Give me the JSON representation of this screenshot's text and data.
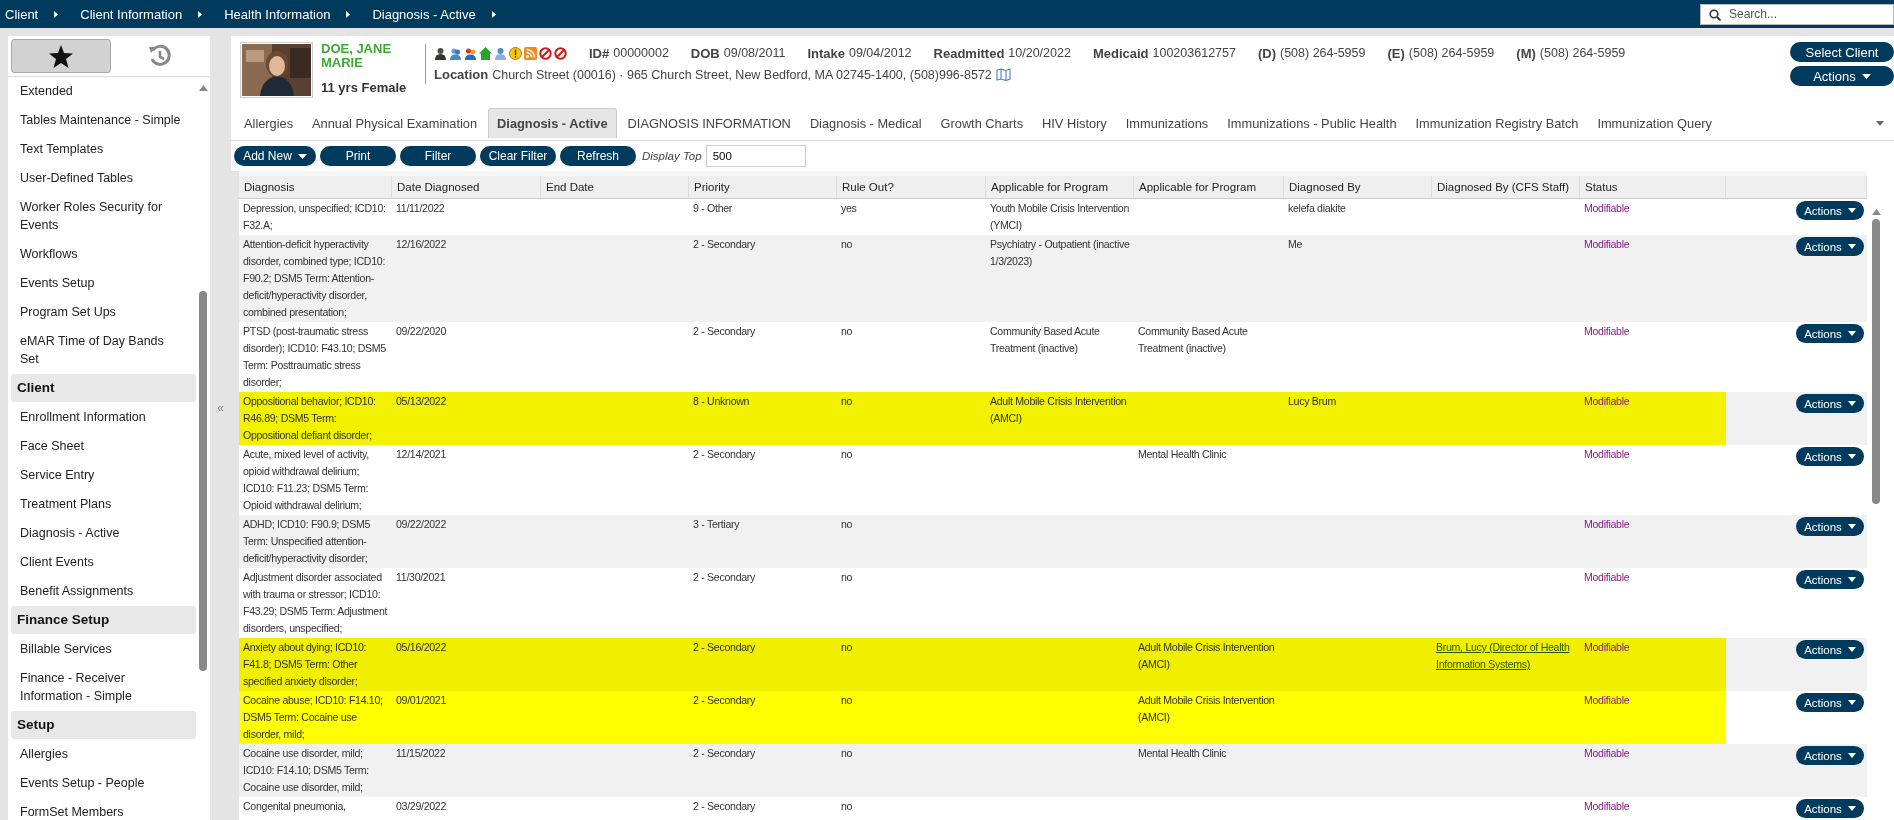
{
  "breadcrumb": [
    {
      "label": "Client"
    },
    {
      "label": "Client Information"
    },
    {
      "label": "Health Information"
    },
    {
      "label": "Diagnosis - Active"
    }
  ],
  "search": {
    "placeholder": "Search..."
  },
  "sidebar": {
    "tabs": [
      {
        "kind": "favorites",
        "selected": true
      },
      {
        "kind": "history",
        "selected": false
      }
    ],
    "items": [
      {
        "kind": "item",
        "label": "Extended"
      },
      {
        "kind": "item",
        "label": "Tables Maintenance - Simple"
      },
      {
        "kind": "item",
        "label": "Text Templates"
      },
      {
        "kind": "item",
        "label": "User-Defined Tables"
      },
      {
        "kind": "item",
        "label": "Worker Roles Security for Events"
      },
      {
        "kind": "item",
        "label": "Workflows"
      },
      {
        "kind": "item",
        "label": "Events Setup"
      },
      {
        "kind": "item",
        "label": "Program Set Ups"
      },
      {
        "kind": "item",
        "label": "eMAR Time of Day Bands Set"
      },
      {
        "kind": "group",
        "label": "Client"
      },
      {
        "kind": "item",
        "label": "Enrollment Information"
      },
      {
        "kind": "item",
        "label": "Face Sheet"
      },
      {
        "kind": "item",
        "label": "Service Entry"
      },
      {
        "kind": "item",
        "label": "Treatment Plans"
      },
      {
        "kind": "item",
        "label": "Diagnosis - Active"
      },
      {
        "kind": "item",
        "label": "Client Events"
      },
      {
        "kind": "item",
        "label": "Benefit Assignments"
      },
      {
        "kind": "group",
        "label": "Finance Setup"
      },
      {
        "kind": "item",
        "label": "Billable Services"
      },
      {
        "kind": "item",
        "label": "Finance - Receiver Information - Simple"
      },
      {
        "kind": "group",
        "label": "Setup"
      },
      {
        "kind": "item",
        "label": "Allergies"
      },
      {
        "kind": "item",
        "label": "Events Setup - People"
      },
      {
        "kind": "item",
        "label": "FormSet Members"
      }
    ]
  },
  "collapse_handle": "«",
  "client": {
    "name": "DOE, JANE MARIE",
    "age_sex": "11 yrs Female",
    "flags": [
      {
        "kind": "staff"
      },
      {
        "kind": "group"
      },
      {
        "kind": "family"
      },
      {
        "kind": "home"
      },
      {
        "kind": "user"
      },
      {
        "kind": "alert"
      },
      {
        "kind": "feed"
      },
      {
        "kind": "blocked"
      },
      {
        "kind": "blocked"
      }
    ],
    "fields": [
      {
        "label": "ID#",
        "value": "00000002"
      },
      {
        "label": "DOB",
        "value": "09/08/2011"
      },
      {
        "label": "Intake",
        "value": "09/04/2012"
      },
      {
        "label": "Readmitted",
        "value": "10/20/2022"
      },
      {
        "label": "Medicaid",
        "value": "100203612757"
      },
      {
        "label": "(D)",
        "value": "(508) 264-5959"
      },
      {
        "label": "(E)",
        "value": "(508) 264-5959"
      },
      {
        "label": "(M)",
        "value": "(508) 264-5959"
      }
    ],
    "location": {
      "label": "Location",
      "value": "Church Street (00016) · 965 Church Street, New Bedford, MA 02745-1400, (508)996-8572"
    }
  },
  "header_buttons": [
    {
      "label": "Select Client",
      "dropdown": false
    },
    {
      "label": "Actions",
      "dropdown": true
    }
  ],
  "tabs": [
    {
      "label": "Allergies",
      "selected": false
    },
    {
      "label": "Annual Physical Examination",
      "selected": false
    },
    {
      "label": "Diagnosis - Active",
      "selected": true
    },
    {
      "label": "DIAGNOSIS INFORMATION",
      "selected": false
    },
    {
      "label": "Diagnosis - Medical",
      "selected": false
    },
    {
      "label": "Growth Charts",
      "selected": false
    },
    {
      "label": "HIV History",
      "selected": false
    },
    {
      "label": "Immunizations",
      "selected": false
    },
    {
      "label": "Immunizations - Public Health",
      "selected": false
    },
    {
      "label": "Immunization Registry Batch",
      "selected": false
    },
    {
      "label": "Immunization Query",
      "selected": false
    }
  ],
  "toolbar": {
    "buttons": [
      {
        "label": "Add New",
        "dropdown": true
      },
      {
        "label": "Print",
        "dropdown": false
      },
      {
        "label": "Filter",
        "dropdown": false
      },
      {
        "label": "Clear Filter",
        "dropdown": false
      },
      {
        "label": "Refresh",
        "dropdown": false
      }
    ],
    "display_top": {
      "label": "Display Top",
      "value": "500"
    }
  },
  "table": {
    "columns": [
      "Diagnosis",
      "Date Diagnosed",
      "End Date",
      "Priority",
      "Rule Out?",
      "Applicable for Program",
      "Applicable for Program",
      "Diagnosed By",
      "Diagnosed By (CFS Staff)",
      "Status"
    ],
    "rows": [
      {
        "diagnosis": "Depression, unspecified; ICD10: F32.A;",
        "date_diagnosed": "11/11/2022",
        "priority": "9 - Other",
        "rule_out": "yes",
        "program": "Youth Mobile Crisis Intervention (YMCI)",
        "diagnosed_by": "kelefa diakite",
        "status": "Modifiable",
        "action": "Actions"
      },
      {
        "diagnosis": "Attention-deficit hyperactivity disorder, combined type; ICD10: F90.2; DSM5 Term: Attention-deficit/hyperactivity disorder, combined presentation;",
        "date_diagnosed": "12/16/2022",
        "priority": "2 - Secondary",
        "rule_out": "no",
        "program": "Psychiatry - Outpatient (inactive 1/3/2023)",
        "diagnosed_by": "Me",
        "status": "Modifiable",
        "action": "Actions"
      },
      {
        "diagnosis": "PTSD (post-traumatic stress disorder); ICD10: F43.10; DSM5 Term: Posttraumatic stress disorder;",
        "date_diagnosed": "09/22/2020",
        "priority": "2 - Secondary",
        "rule_out": "no",
        "program": "Community Based Acute Treatment (inactive)",
        "program_2": "Community Based Acute Treatment (inactive)",
        "status": "Modifiable",
        "action": "Actions"
      },
      {
        "diagnosis": "Oppositional behavior; ICD10: R46.89; DSM5 Term: Oppositional defiant disorder;",
        "date_diagnosed": "05/13/2022",
        "priority": "8 - Unknown",
        "rule_out": "no",
        "program": "Adult Mobile Crisis Intervention (AMCI)",
        "diagnosed_by": "Lucy Brum",
        "status": "Modifiable",
        "action": "Actions",
        "color": "#f2f200"
      },
      {
        "diagnosis": "Acute, mixed level of activity, opioid withdrawal delirium; ICD10: F11.23; DSM5 Term: Opioid withdrawal delirium;",
        "date_diagnosed": "12/14/2021",
        "priority": "2 - Secondary",
        "rule_out": "no",
        "program_2": "Mental Health Clinic",
        "status": "Modifiable",
        "action": "Actions"
      },
      {
        "diagnosis": "ADHD; ICD10: F90.9; DSM5 Term: Unspecified attention-deficit/hyperactivity disorder;",
        "date_diagnosed": "09/22/2022",
        "priority": "3 - Tertiary",
        "rule_out": "no",
        "status": "Modifiable",
        "action": "Actions"
      },
      {
        "diagnosis": "Adjustment disorder associated with trauma or stressor; ICD10: F43.29; DSM5 Term: Adjustment disorders, unspecified;",
        "date_diagnosed": "11/30/2021",
        "priority": "2 - Secondary",
        "rule_out": "no",
        "status": "Modifiable",
        "action": "Actions"
      },
      {
        "diagnosis": "Anxiety about dying; ICD10: F41.8; DSM5 Term: Other specified anxiety disorder;",
        "date_diagnosed": "05/16/2022",
        "priority": "2 - Secondary",
        "rule_out": "no",
        "program_2": "Adult Mobile Crisis Intervention (AMCI)",
        "cfs_staff": "Brum, Lucy (Director of Health Information Systems)",
        "status": "Modifiable",
        "action": "Actions",
        "color": "#f0ef00"
      },
      {
        "diagnosis": "Cocaine abuse; ICD10: F14.10; DSM5 Term: Cocaine use disorder, mild;",
        "date_diagnosed": "09/01/2021",
        "priority": "2 - Secondary",
        "rule_out": "no",
        "program_2": "Adult Mobile Crisis Intervention (AMCI)",
        "status": "Modifiable",
        "action": "Actions",
        "color": "#ffff00"
      },
      {
        "diagnosis": "Cocaine use disorder, mild; ICD10: F14.10; DSM5 Term: Cocaine use disorder, mild;",
        "date_diagnosed": "11/15/2022",
        "priority": "2 - Secondary",
        "rule_out": "no",
        "program_2": "Mental Health Clinic",
        "status": "Modifiable",
        "action": "Actions"
      },
      {
        "diagnosis": "Congenital pneumonia,",
        "date_diagnosed": "03/29/2022",
        "priority": "2 - Secondary",
        "rule_out": "no",
        "status": "Modifiable",
        "action": "Actions"
      }
    ]
  }
}
